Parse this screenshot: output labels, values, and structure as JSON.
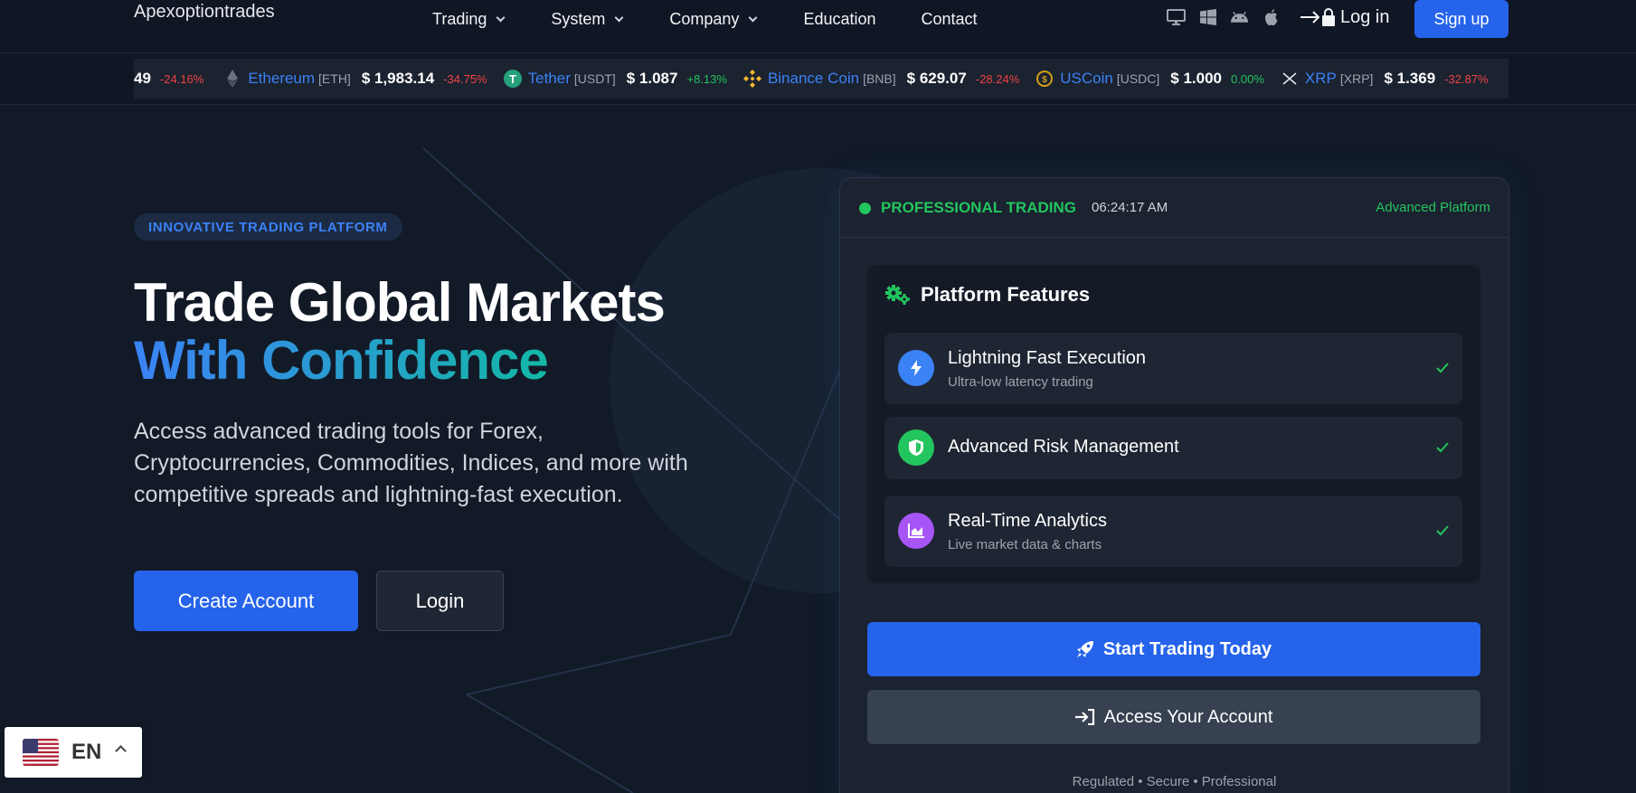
{
  "header": {
    "logo": "Apexoptiontrades",
    "nav": [
      {
        "label": "Trading",
        "dropdown": true
      },
      {
        "label": "System",
        "dropdown": true
      },
      {
        "label": "Company",
        "dropdown": true
      },
      {
        "label": "Education",
        "dropdown": false
      },
      {
        "label": "Contact",
        "dropdown": false
      }
    ],
    "platforms": [
      "desktop-icon",
      "windows-icon",
      "android-icon",
      "apple-icon"
    ],
    "login_label": "Log in",
    "signup_label": "Sign up"
  },
  "ticker": [
    {
      "name": "",
      "symbol": "",
      "price": "49",
      "change": "-24.16%",
      "dir": "neg",
      "icon": "none"
    },
    {
      "name": "Ethereum",
      "symbol": "[ETH]",
      "price": "$ 1,983.14",
      "change": "-34.75%",
      "dir": "neg",
      "icon": "ethereum-icon"
    },
    {
      "name": "Tether",
      "symbol": "[USDT]",
      "price": "$ 1.087",
      "change": "+8.13%",
      "dir": "pos",
      "icon": "tether-icon"
    },
    {
      "name": "Binance Coin",
      "symbol": "[BNB]",
      "price": "$ 629.07",
      "change": "-28.24%",
      "dir": "neg",
      "icon": "binance-icon"
    },
    {
      "name": "USCoin",
      "symbol": "[USDC]",
      "price": "$ 1.000",
      "change": "0.00%",
      "dir": "pos",
      "icon": "usdc-icon"
    },
    {
      "name": "XRP",
      "symbol": "[XRP]",
      "price": "$ 1.369",
      "change": "-32.87%",
      "dir": "neg",
      "icon": "xrp-icon"
    }
  ],
  "hero": {
    "badge": "INNOVATIVE TRADING PLATFORM",
    "title_line1": "Trade Global Markets",
    "title_line2": "With Confidence",
    "description": "Access advanced trading tools for Forex, Cryptocurrencies, Commodities, Indices, and more with competitive spreads and lightning-fast execution.",
    "create_label": "Create Account",
    "login_label": "Login"
  },
  "card": {
    "status": "PROFESSIONAL TRADING",
    "time": "06:24:17 AM",
    "tag": "Advanced Platform",
    "features_title": "Platform Features",
    "features": [
      {
        "title": "Lightning Fast Execution",
        "subtitle": "Ultra-low latency trading",
        "icon": "lightning-icon",
        "color": "#3b82f6"
      },
      {
        "title": "Advanced Risk Management",
        "subtitle": "",
        "icon": "shield-icon",
        "color": "#22c55e"
      },
      {
        "title": "Real-Time Analytics",
        "subtitle": "Live market data & charts",
        "icon": "chart-area-icon",
        "color": "#a855f7"
      }
    ],
    "start_label": "Start Trading Today",
    "access_label": "Access Your Account",
    "footnote": "Regulated • Secure • Professional"
  },
  "language": {
    "code": "EN",
    "flag": "us-flag-icon"
  },
  "colors": {
    "accent": "#2563eb",
    "success": "#22c55e",
    "danger": "#ef4444",
    "background": "#121a28"
  }
}
